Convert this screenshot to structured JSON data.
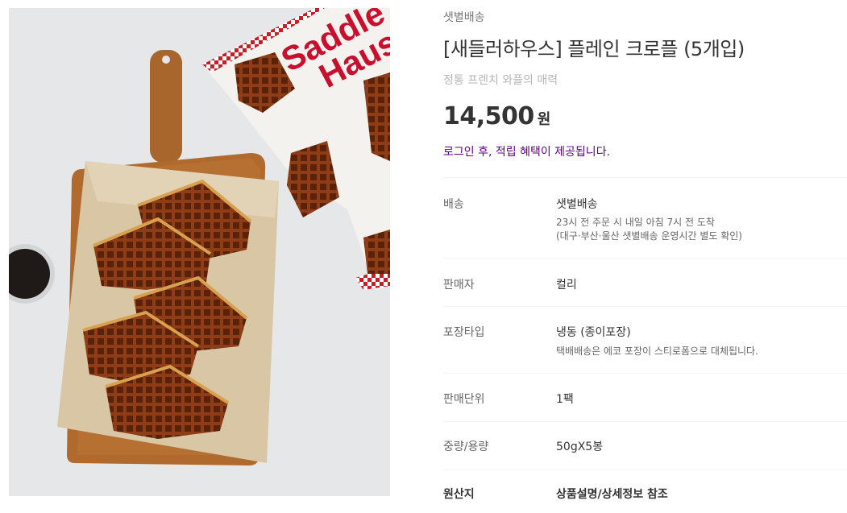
{
  "product_image": {
    "alt": "[새들러하우스] 플레인 크로플 (5개입)",
    "package_text": [
      "Saddle",
      "Haus"
    ]
  },
  "product": {
    "delivery_tag": "샛별배송",
    "title": "[새들러하우스] 플레인 크로플 (5개입)",
    "subtitle": "정통 프렌치 와플의 매력",
    "price": "14,500",
    "price_unit": "원",
    "login_benefit": "로그인 후, 적립 혜택이 제공됩니다."
  },
  "specs": [
    {
      "label": "배송",
      "value": "샛별배송",
      "notes": [
        "23시 전 주문 시 내일 아침 7시 전 도착",
        "(대구·부산·울산 샛별배송 운영시간 별도 확인)"
      ]
    },
    {
      "label": "판매자",
      "value": "컬리",
      "notes": []
    },
    {
      "label": "포장타입",
      "value": "냉동 (종이포장)",
      "notes": [
        "택배배송은 에코 포장이 스티로폼으로 대체됩니다."
      ]
    },
    {
      "label": "판매단위",
      "value": "1팩",
      "notes": []
    },
    {
      "label": "중량/용량",
      "value": "50gX5봉",
      "notes": []
    },
    {
      "label": "원산지",
      "value": "상품설명/상세정보 참조",
      "notes": []
    }
  ],
  "colors": {
    "accent": "#5f0080",
    "text": "#333333",
    "muted": "#999999",
    "divider": "#f4f4f4"
  }
}
